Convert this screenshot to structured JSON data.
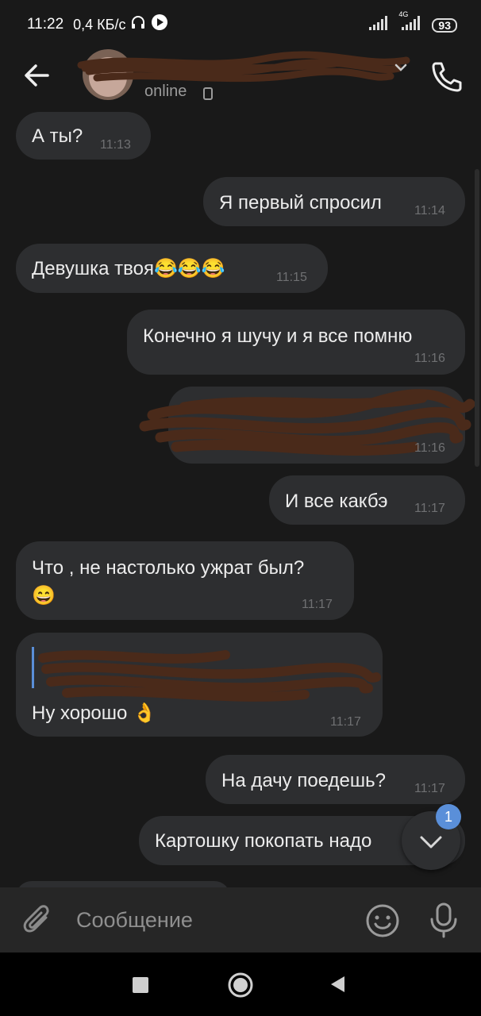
{
  "status_bar": {
    "time": "11:22",
    "speed": "0,4 КБ/с",
    "network": "4G",
    "battery": "93"
  },
  "chat_header": {
    "status": "online"
  },
  "messages": [
    {
      "text": "А ты?",
      "time": "11:13",
      "direction": "in"
    },
    {
      "text": "Я первый спросил",
      "time": "11:14",
      "direction": "out"
    },
    {
      "text": "Девушка твоя😂😂😂",
      "time": "11:15",
      "direction": "in"
    },
    {
      "text": "Конечно я шучу и я все помню",
      "time": "11:16",
      "direction": "out"
    },
    {
      "text": "",
      "time": "11:16",
      "direction": "out",
      "redacted": true
    },
    {
      "text": "И все какбэ",
      "time": "11:17",
      "direction": "out"
    },
    {
      "text": "Что , не настолько ужрат был?",
      "text2": "😄",
      "time": "11:17",
      "direction": "in"
    },
    {
      "text": "Ну хорошо 👌",
      "time": "11:17",
      "direction": "in",
      "reply": true
    },
    {
      "text": "На дачу поедешь?",
      "time": "11:17",
      "direction": "out"
    },
    {
      "text": "Картошку покопать надо",
      "direction": "out"
    }
  ],
  "scroll_button": {
    "badge": "1"
  },
  "composer": {
    "placeholder": "Сообщение"
  },
  "colors": {
    "background": "#191919",
    "bubble": "#2d2e30",
    "badge": "#5a8fd9",
    "scribble": "#4a2a1a"
  }
}
